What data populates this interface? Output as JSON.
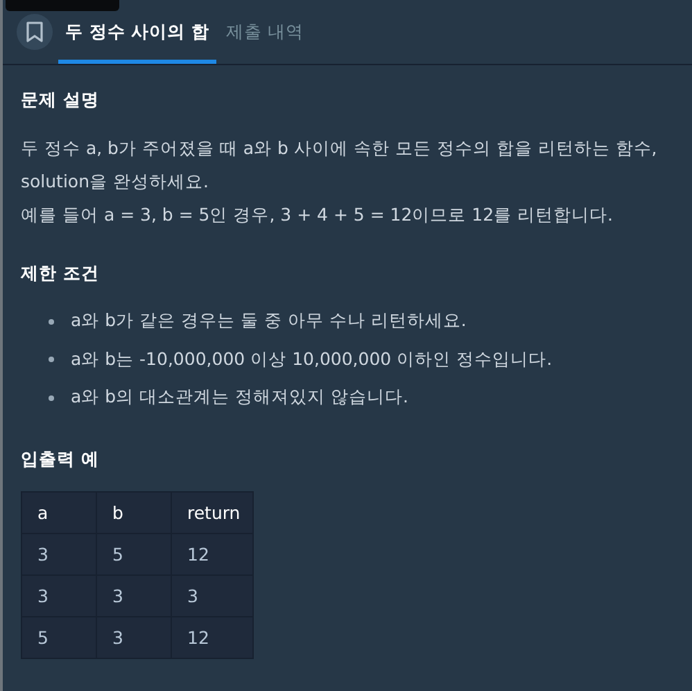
{
  "tabs": [
    {
      "label": "두 정수 사이의 합",
      "selected": true
    },
    {
      "label": "제출 내역",
      "selected": false
    }
  ],
  "description": {
    "heading": "문제 설명",
    "lines": [
      "두 정수 a, b가 주어졌을 때 a와 b 사이에 속한 모든 정수의 합을 리턴하는 함수, solution을 완성하세요.",
      "예를 들어 a = 3, b = 5인 경우, 3 + 4 + 5 = 12이므로 12를 리턴합니다."
    ]
  },
  "constraints": {
    "heading": "제한 조건",
    "items": [
      "a와 b가 같은 경우는 둘 중 아무 수나 리턴하세요.",
      "a와 b는 -10,000,000 이상 10,000,000 이하인 정수입니다.",
      "a와 b의 대소관계는 정해져있지 않습니다."
    ]
  },
  "examples": {
    "heading": "입출력 예",
    "table": {
      "columns": [
        "a",
        "b",
        "return"
      ],
      "rows": [
        [
          "3",
          "5",
          "12"
        ],
        [
          "3",
          "3",
          "3"
        ],
        [
          "5",
          "3",
          "12"
        ]
      ]
    }
  }
}
